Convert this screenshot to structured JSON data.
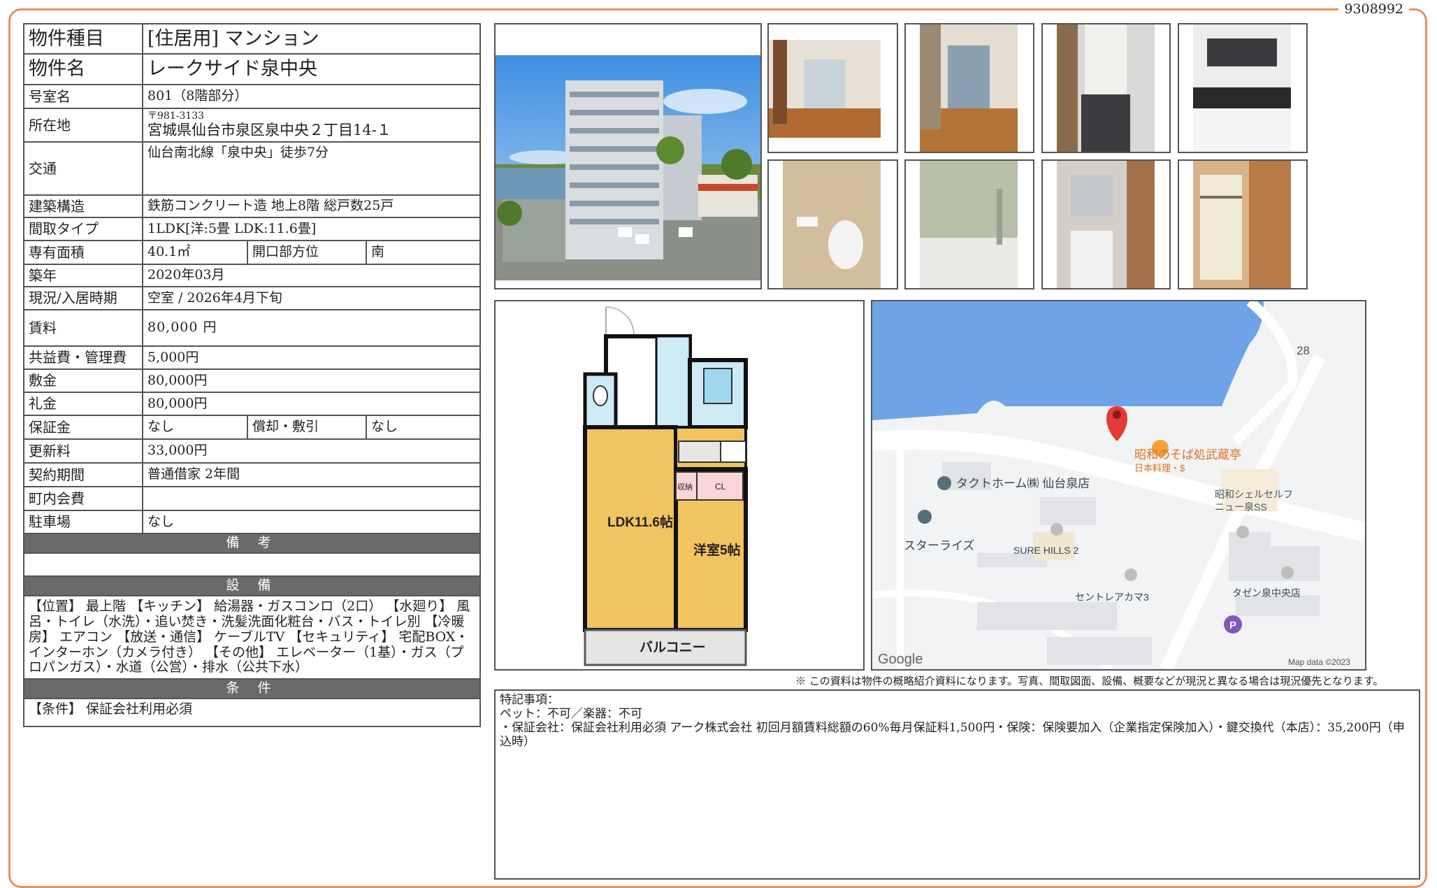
{
  "property_code": "9308992",
  "info": {
    "type_label": "物件種目",
    "type_value": "[住居用]  マンション",
    "name_label": "物件名",
    "name_value": "レークサイド泉中央",
    "room_label": "号室名",
    "room_value": "801（8階部分）",
    "address_label": "所在地",
    "address_zip": "〒981-3133",
    "address_value": "宮城県仙台市泉区泉中央２丁目14-１",
    "access_label": "交通",
    "access_value": "仙台南北線「泉中央」徒歩7分",
    "structure_label": "建築構造",
    "structure_value": "鉄筋コンクリート造  地上8階  総戸数25戸",
    "layout_label": "間取タイプ",
    "layout_value": "1LDK[洋:5畳 LDK:11.6畳]",
    "area_label": "専有面積",
    "area_value": "40.1㎡",
    "direction_label": "開口部方位",
    "direction_value": "南",
    "built_label": "築年",
    "built_value": "2020年03月",
    "status_label": "現況/入居時期",
    "status_value": "空室  /  2026年4月下旬",
    "rent_label": "賃料",
    "rent_value": "80,000 円",
    "common_label": "共益費・管理費",
    "common_value": "5,000円",
    "deposit_label": "敷金",
    "deposit_value": "80,000円",
    "keymoney_label": "礼金",
    "keymoney_value": "80,000円",
    "guarantee_label": "保証金",
    "guarantee_value": "なし",
    "amort_label": "償却・敷引",
    "amort_value": "なし",
    "renewal_label": "更新料",
    "renewal_value": "33,000円",
    "contract_label": "契約期間",
    "contract_value": "普通借家  2年間",
    "townfee_label": "町内会費",
    "townfee_value": "",
    "parking_label": "駐車場",
    "parking_value": "なし"
  },
  "remarks": {
    "heading": "備 考",
    "text": ""
  },
  "equipment": {
    "heading": "設 備",
    "text": "【位置】 最上階 【キッチン】 給湯器・ガスコンロ（2口） 【水廻り】 風呂・トイレ（水洗）・追い焚き・洗髪洗面化粧台・バス・トイレ別 【冷暖房】 エアコン 【放送・通信】 ケーブルTV 【セキュリティ】 宅配BOX・インターホン（カメラ付き） 【その他】 エレベーター（1基）・ガス（プロパンガス）・水道（公営）・排水（公共下水）"
  },
  "conditions": {
    "heading": "条 件",
    "text": "【条件】 保証会社利用必須"
  },
  "floorplan": {
    "ldk_label": "LDK11.6帖",
    "western_label": "洋室5帖",
    "balcony_label": "バルコニー",
    "storage_label": "収納",
    "closet_label": "CL"
  },
  "map": {
    "labels": [
      "昭和のそば処武蔵亭",
      "日本料理・$",
      "タクトホーム㈱ 仙台泉店",
      "昭和シェルセルフ",
      "ニュー泉SS",
      "スターライズ",
      "SURE HILLS 2",
      "セントレアカマ3",
      "タゼン泉中央店",
      "28"
    ],
    "google": "Google",
    "attribution": "Map data ©2023"
  },
  "disclaimer": "※ この資料は物件の概略紹介資料になります。写真、間取図面、設備、概要などが現況と異なる場合は現況優先となります。",
  "special": {
    "heading": "特記事項：",
    "line1": "ペット：不可／楽器：不可",
    "line2": "・保証会社：保証会社利用必須 アーク株式会社 初回月額賃料総額の60%毎月保証料1,500円・保険：保険要加入（企業指定保険加入）・鍵交換代（本店）：35,200円（申込時）"
  },
  "colors": {
    "frame": "#e8925a",
    "section_header": "#6a6a6a",
    "map_water": "#6fa3e8",
    "floor_room": "#f2c460"
  }
}
